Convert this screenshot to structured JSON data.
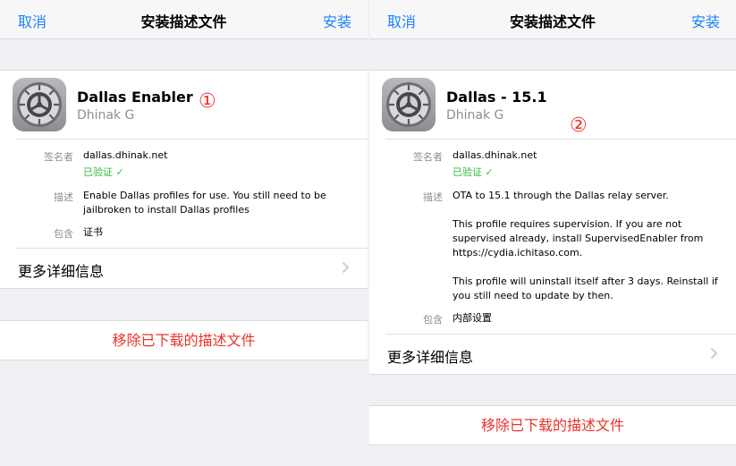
{
  "panels": [
    {
      "nav": {
        "cancel": "取消",
        "title": "安装描述文件",
        "install": "安装"
      },
      "profile": {
        "name": "Dallas Enabler",
        "author": "Dhinak G"
      },
      "marker": "①",
      "signer": {
        "label": "签名者",
        "value": "dallas.dhinak.net",
        "verified": "已验证 ✓"
      },
      "description": {
        "label": "描述",
        "paragraphs": [
          "Enable Dallas profiles for use. You still need to be jailbroken to install Dallas profiles"
        ]
      },
      "contains": {
        "label": "包含",
        "value": "证书"
      },
      "more_details": "更多详细信息",
      "remove": "移除已下载的描述文件"
    },
    {
      "nav": {
        "cancel": "取消",
        "title": "安装描述文件",
        "install": "安装"
      },
      "profile": {
        "name": "Dallas - 15.1",
        "author": "Dhinak G"
      },
      "marker": "②",
      "signer": {
        "label": "签名者",
        "value": "dallas.dhinak.net",
        "verified": "已验证 ✓"
      },
      "description": {
        "label": "描述",
        "paragraphs": [
          "OTA to 15.1 through the Dallas relay server.",
          "This profile requires supervision. If you are not supervised already, install SupervisedEnabler from https://cydia.ichitaso.com.",
          "This profile will uninstall itself after 3 days. Reinstall if you still need to update by then."
        ]
      },
      "contains": {
        "label": "包含",
        "value": "内部设置"
      },
      "more_details": "更多详细信息",
      "remove": "移除已下载的描述文件"
    }
  ],
  "colors": {
    "accent": "#1a82fb",
    "destructive": "#e8342b",
    "verified": "#2dbf3c"
  },
  "icons": {
    "profile": "settings-gear-icon",
    "disclosure": "chevron-right-icon"
  }
}
